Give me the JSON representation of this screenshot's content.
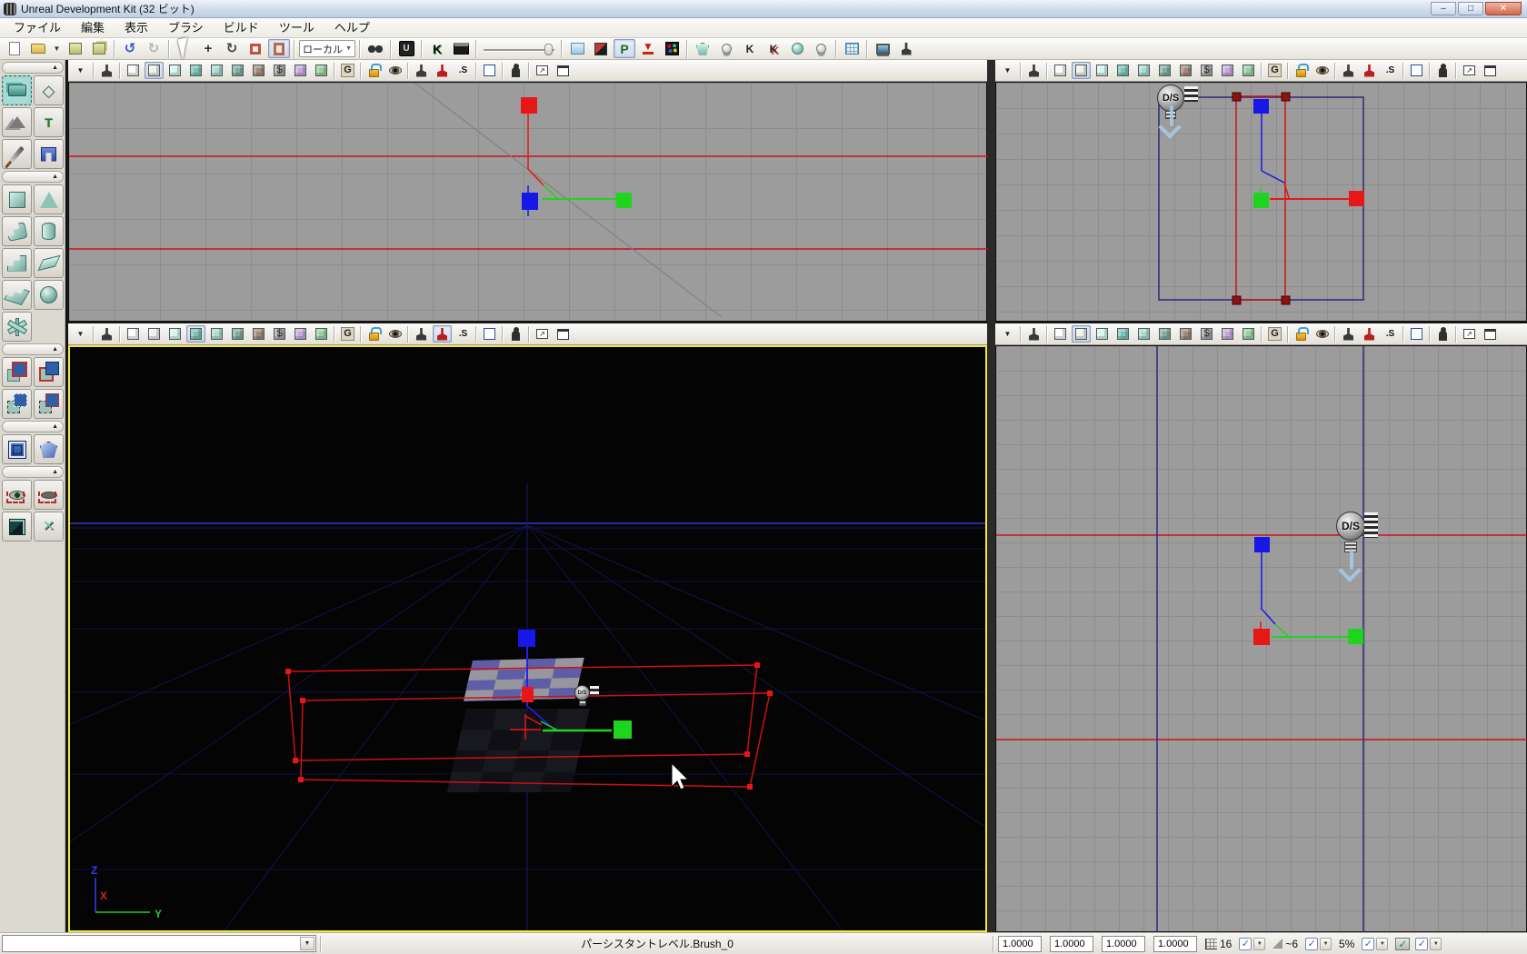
{
  "window": {
    "title": "Unreal Development Kit (32 ビット)",
    "minimize_glyph": "–",
    "maximize_glyph": "□",
    "close_glyph": "✕"
  },
  "menu": {
    "items": [
      {
        "n": "menu-file",
        "g": "ファイル"
      },
      {
        "n": "menu-edit",
        "g": "編集"
      },
      {
        "n": "menu-view",
        "g": "表示"
      },
      {
        "n": "menu-brush",
        "g": "ブラシ"
      },
      {
        "n": "menu-build",
        "g": "ビルド"
      },
      {
        "n": "menu-tools",
        "g": "ツール"
      },
      {
        "n": "menu-help",
        "g": "ヘルプ"
      }
    ]
  },
  "main_toolbar": {
    "items": [
      {
        "n": "new-file-button",
        "c": "i-page"
      },
      {
        "n": "open-file-button",
        "c": "i-folder"
      },
      {
        "n": "open-recent-dropdown",
        "c": "i-dd",
        "g": "▼"
      },
      {
        "n": "save-button",
        "c": "i-save"
      },
      {
        "n": "save-all-button",
        "c": "i-saveall"
      },
      {
        "t": "sep"
      },
      {
        "n": "undo-button",
        "c": "i-undo",
        "g": "↺"
      },
      {
        "n": "redo-button",
        "c": "i-redo",
        "g": "↻"
      },
      {
        "t": "sep"
      },
      {
        "n": "select-tool-button",
        "c": "i-cursor"
      },
      {
        "n": "translate-tool-button",
        "c": "i-move",
        "g": "+"
      },
      {
        "n": "rotate-tool-button",
        "c": "i-rot",
        "g": "↻"
      },
      {
        "n": "scale-tool-button",
        "c": "i-scale"
      },
      {
        "n": "scale-nonuniform-tool-button",
        "c": "i-scalenu",
        "p": true
      },
      {
        "t": "sep"
      },
      {
        "n": "coordinate-system-select",
        "t": "combo",
        "g": "ローカル"
      },
      {
        "t": "sep"
      },
      {
        "n": "search-actors-button",
        "c": "i-binoc"
      },
      {
        "t": "sep"
      },
      {
        "n": "udk-frontend-button",
        "c": "i-udk",
        "g": "U"
      },
      {
        "t": "sep"
      },
      {
        "n": "kismet-button",
        "c": "i-kismet",
        "g": "K"
      },
      {
        "n": "matinee-button",
        "c": "i-matinee"
      },
      {
        "t": "sep"
      },
      {
        "n": "camera-speed-slider",
        "t": "slider"
      },
      {
        "t": "sep"
      },
      {
        "n": "content-browser-button",
        "c": "i-cbrowser"
      },
      {
        "n": "brush-polys-toggle",
        "c": "i-brushdiag"
      },
      {
        "n": "play-in-viewport-button",
        "c": "i-play-p",
        "g": "P",
        "p": true
      },
      {
        "n": "drop-to-floor-button",
        "c": "i-drop",
        "g": "▼"
      },
      {
        "n": "emitter-browser-button",
        "c": "i-dots"
      },
      {
        "t": "sep"
      },
      {
        "n": "socket-manager-button",
        "c": "i-shield"
      },
      {
        "n": "toggle-lights-button",
        "c": "i-bulb"
      },
      {
        "n": "kismet-curve1-button",
        "c": "i-kcurve",
        "g": "K"
      },
      {
        "n": "kismet-curve2-button",
        "c": "i-kcurve2",
        "g": "K"
      },
      {
        "n": "sphere-light-button",
        "c": "i-spherebulb"
      },
      {
        "n": "light-quality-button",
        "c": "i-bulb2"
      },
      {
        "t": "sep"
      },
      {
        "n": "realtime-grid-button",
        "c": "i-gridblue"
      },
      {
        "t": "sep"
      },
      {
        "n": "build-all-button",
        "c": "i-build"
      },
      {
        "n": "play-level-button",
        "c": "i-joy"
      }
    ]
  },
  "sidebar": {
    "items": [
      {
        "t": "hdr",
        "n": "modes-section-header"
      },
      {
        "n": "camera-mode-button",
        "c": "s-camera",
        "p": true
      },
      {
        "n": "geometry-mode-button",
        "c": "s-geom",
        "g": "◇"
      },
      {
        "n": "terrain-mode-button",
        "c": "s-terrain"
      },
      {
        "n": "texture-align-mode-button",
        "c": "s-movet",
        "g": "T"
      },
      {
        "n": "mesh-paint-mode-button",
        "c": "s-paint"
      },
      {
        "n": "static-mesh-mode-button",
        "c": "s-bluemesh"
      },
      {
        "t": "hdr",
        "n": "brush-primitives-header"
      },
      {
        "n": "cube-brush-button",
        "c": "s-cube"
      },
      {
        "n": "cone-brush-button",
        "c": "s-cone"
      },
      {
        "n": "curved-stairs-brush-button",
        "c": "s-curvedstairs"
      },
      {
        "n": "cylinder-brush-button",
        "c": "s-cylinder"
      },
      {
        "n": "linear-stairs-brush-button",
        "c": "s-stairs"
      },
      {
        "n": "sheet-brush-button",
        "c": "s-sheet"
      },
      {
        "n": "spiral-stairs-brush-button",
        "c": "s-spiral"
      },
      {
        "n": "sphere-brush-button",
        "c": "s-sphere"
      },
      {
        "n": "volumetric-brush-button",
        "c": "s-volumetric"
      },
      {
        "t": "hdr",
        "n": "csg-section-header"
      },
      {
        "n": "csg-add-button",
        "c": "s-csgadd"
      },
      {
        "n": "csg-subtract-button",
        "c": "s-csgsub"
      },
      {
        "n": "csg-intersect-button",
        "c": "s-csgint"
      },
      {
        "n": "csg-deintersect-button",
        "c": "s-csgdeint"
      },
      {
        "t": "hdr",
        "n": "special-section-header"
      },
      {
        "n": "add-special-brush-button",
        "c": "s-special"
      },
      {
        "n": "add-volume-button",
        "c": "s-volume"
      },
      {
        "t": "hdr",
        "n": "visibility-section-header"
      },
      {
        "n": "show-selected-only-button",
        "c": "s-eyeshow"
      },
      {
        "n": "hide-selected-button",
        "c": "s-eyehide"
      },
      {
        "n": "invert-selection-button",
        "c": "s-invert"
      },
      {
        "n": "show-all-button",
        "c": "s-showall",
        "g": "✕"
      }
    ]
  },
  "viewports": {
    "toolbar_icons": [
      {
        "n": "viewport-options-dropdown",
        "c": "i-dd2",
        "g": "▼"
      },
      {
        "t": "sep"
      },
      {
        "n": "realtime-toggle",
        "c": "i-joy-s"
      },
      {
        "t": "sep"
      },
      {
        "n": "view-wireframe-button",
        "c": "cube wirecube"
      },
      {
        "n": "view-brush-wireframe-button",
        "c": "cube brushcube"
      },
      {
        "n": "view-unlit-button",
        "c": "cube unlitcube"
      },
      {
        "n": "view-lit-button",
        "c": "cube litcube"
      },
      {
        "n": "view-detail-lighting-button",
        "c": "cube detailcube"
      },
      {
        "n": "view-lighting-only-button",
        "c": "cube lightonlycube"
      },
      {
        "n": "view-light-complexity-button",
        "c": "cube complexcube"
      },
      {
        "n": "view-shader-complexity-button",
        "c": "cube shadercube",
        "g": "$"
      },
      {
        "n": "view-lightmap-density-button",
        "c": "cube lightmapcube"
      },
      {
        "n": "view-texture-density-button",
        "c": "cube densitycube"
      },
      {
        "t": "sep"
      },
      {
        "n": "game-view-toggle",
        "c": "i-g",
        "g": "G"
      },
      {
        "t": "sep"
      },
      {
        "n": "viewport-lock-toggle",
        "c": "i-lock"
      },
      {
        "n": "show-flags-button",
        "c": "i-eye"
      },
      {
        "t": "sep"
      },
      {
        "n": "unlit-movement-toggle",
        "c": "i-joy-dark"
      },
      {
        "n": "level-streaming-volume-preview-toggle",
        "c": "i-joy-red"
      },
      {
        "n": "squint-mode-toggle",
        "c": "i-squint",
        "g": ".S"
      },
      {
        "t": "sep"
      },
      {
        "n": "maximize-viewport-button",
        "c": "i-sq"
      },
      {
        "t": "sep"
      },
      {
        "n": "player-start-here-button",
        "c": "i-person"
      },
      {
        "t": "sep"
      },
      {
        "n": "float-viewport-button",
        "c": "i-float",
        "g": "↗"
      },
      {
        "n": "resize-viewport-button",
        "c": "i-sq2"
      }
    ],
    "light_sprite_label": "D/S",
    "perspective_axis_labels": {
      "z": "Z",
      "x": "X",
      "y": "Y"
    }
  },
  "status_bar": {
    "level_selector_value": "",
    "current_level_text": "パーシスタントレベル.Brush_0",
    "drag_grid_values": [
      "1.0000",
      "1.0000",
      "1.0000",
      "1.0000"
    ],
    "grid_snap_value": "16",
    "rotation_snap_value": "~6",
    "scale_snap_value": "5%",
    "checkbox_glyph": "✓",
    "dropdown_glyph": "▼"
  },
  "colors": {
    "widget_x_axis": "#e81717",
    "widget_y_axis": "#1ed41e",
    "widget_z_axis": "#1717e8",
    "builder_brush_wire": "#cc1111",
    "blue_volume_wire": "#2a2a7a",
    "ortho_background": "#9c9c9c",
    "active_viewport_border": "#f5e73a"
  }
}
